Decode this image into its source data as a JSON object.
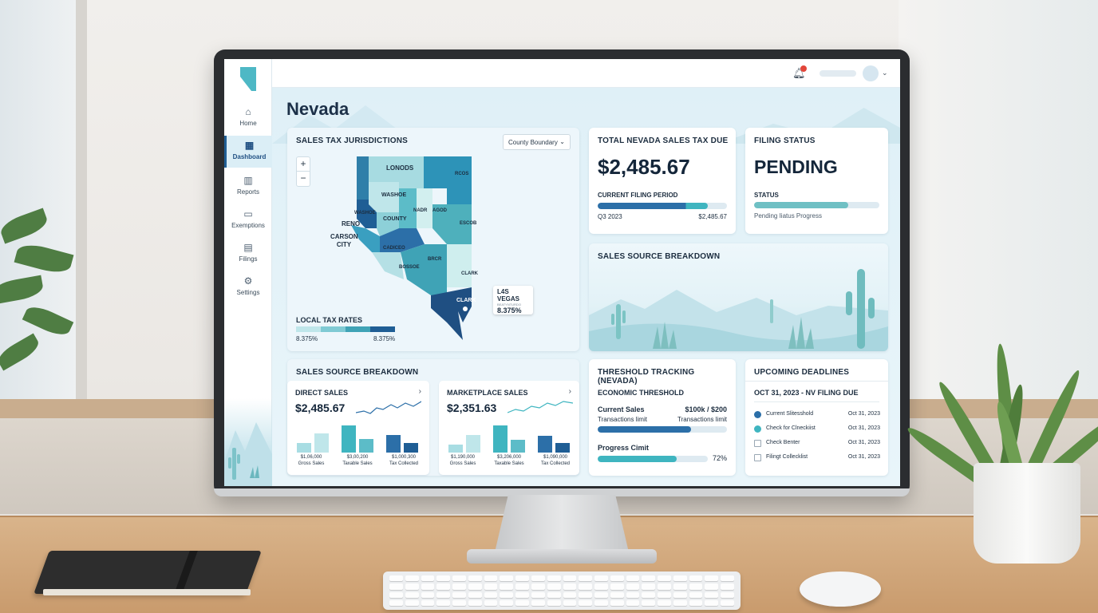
{
  "sidebar": {
    "items": [
      {
        "label": "Home",
        "icon": "home-icon",
        "active": false
      },
      {
        "label": "Dashboard",
        "icon": "dashboard-icon",
        "active": true
      },
      {
        "label": "Reports",
        "icon": "reports-icon",
        "active": false
      },
      {
        "label": "Exemptions",
        "icon": "briefcase-icon",
        "active": false
      },
      {
        "label": "Filings",
        "icon": "document-icon",
        "active": false
      },
      {
        "label": "Settings",
        "icon": "gear-icon",
        "active": false
      }
    ]
  },
  "topbar": {
    "notification_count": "1"
  },
  "page": {
    "title": "Nevada"
  },
  "jurisdictions": {
    "title": "SALES TAX JURISDICTIONS",
    "select_value": "County Boundary",
    "zoom_in": "+",
    "zoom_out": "−",
    "map_labels": [
      "LONODS",
      "RCOS",
      "WASHOE",
      "WASHOE",
      "NADR",
      "AGOD",
      "COUNTY",
      "RENO",
      "CARSON CITY",
      "ESCOB",
      "CADICEO",
      "BOSSOE",
      "BRCR",
      "CLARK",
      "CLARK"
    ],
    "popup": {
      "name": "L4S VEGAS",
      "sub": "BEATYNTURDO",
      "rate": "8.375%"
    },
    "local_rates_title": "LOCAL TAX RATES",
    "rate_min": "8.375%",
    "rate_max": "8.375%"
  },
  "total_due": {
    "title": "TOTAL NEVADA SALES TAX DUE",
    "amount": "$2,485.67",
    "period_title": "CURRENT FILING PERIOD",
    "period_label": "Q3 2023",
    "period_amount": "$2,485.67",
    "period_progress": 0.85
  },
  "filing_status": {
    "title": "FILING STATUS",
    "status": "PENDING",
    "status_label": "STATUS",
    "progress_label": "Pending Iiatus Progress",
    "progress": 0.75
  },
  "source_top": {
    "title": "SALES SOURCE BREAKDOWN"
  },
  "source_bottom": {
    "title": "SALES SOURCE BREAKDOWN",
    "direct": {
      "title": "DIRECT SALES",
      "amount": "$2,485.67",
      "labels": [
        {
          "value": "$1,06,000",
          "name": "Gross Sales"
        },
        {
          "value": "$3,00,200",
          "name": "Taxable Sales"
        },
        {
          "value": "$1,000,300",
          "name": "Tax Collected"
        }
      ]
    },
    "marketplace": {
      "title": "MARKETPLACE SALES",
      "amount": "$2,351.63",
      "labels": [
        {
          "value": "$1,190,000",
          "name": "Gross Sales"
        },
        {
          "value": "$3,206,000",
          "name": "Taxable Sales"
        },
        {
          "value": "$1,090,000",
          "name": "Tax Collected"
        }
      ]
    }
  },
  "threshold": {
    "title": "THRESHOLD TRACKING (NEVADA)",
    "economic": "ECONOMIC THRESHOLD",
    "current_sales": "Current Sales",
    "current_value": "$100k / $200",
    "trans_left": "Transactions limit",
    "trans_right": "Transactions limit",
    "current_progress": 0.72,
    "progress_label": "Progress Cimit",
    "progress_value": "72%",
    "progress": 0.72
  },
  "deadlines": {
    "title": "UPCOMING DEADLINES",
    "heading": "OCT 31, 2023 - NV FILING DUE",
    "items": [
      {
        "text": "Current Slitesshold",
        "date": "Oct 31, 2023",
        "done": true
      },
      {
        "text": "Check for Clneckiist",
        "date": "Oct 31, 2023",
        "done": true
      },
      {
        "text": "Check Benter",
        "date": "Oct 31, 2023",
        "done": false
      },
      {
        "text": "Filingt Collecklist",
        "date": "Oct 31, 2023",
        "done": false
      }
    ]
  },
  "colors": {
    "navy": "#1f4f82",
    "teal": "#3fb5c0",
    "light_teal": "#8ad3da",
    "blue": "#2c6fa8"
  }
}
